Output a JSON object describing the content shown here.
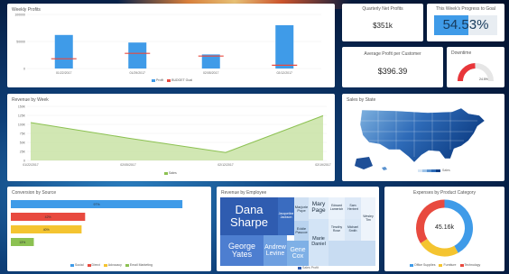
{
  "colors": {
    "primary": "#3f9be8",
    "accent_red": "#e84a3f",
    "green": "#8cc152",
    "yellow": "#f4c430",
    "gauge_red": "#e8363a"
  },
  "weekly_profits": {
    "title": "Weekly Profits",
    "y_ticks": [
      "100000",
      "50000",
      "0"
    ],
    "legend": [
      "Profit",
      "BUDGET Goal"
    ],
    "chart_data": {
      "type": "bar",
      "categories": [
        "01/22/2017",
        "01/29/2017",
        "02/05/2017",
        "02/12/2017"
      ],
      "series": [
        {
          "name": "Profit",
          "values": [
            62000,
            48000,
            26000,
            80000
          ]
        },
        {
          "name": "BUDGET Goal",
          "values": [
            18000,
            28000,
            23000,
            6000
          ]
        }
      ],
      "ylim": [
        0,
        100000
      ]
    }
  },
  "quarterly_net_profits": {
    "label": "Quarterly Net Profits",
    "value": "$351k"
  },
  "progress_to_goal": {
    "label": "This Week's Progress to Goal",
    "value": "54.53%",
    "progress": 0.5453
  },
  "avg_profit_per_customer": {
    "label": "Average Profit per Customer",
    "value": "$396.39"
  },
  "downtime": {
    "label": "Downtime",
    "value": "24.5%",
    "fraction": 0.245
  },
  "revenue_by_week": {
    "title": "Revenue by Week",
    "y_ticks": [
      "150K",
      "125K",
      "100K",
      "75K",
      "50K",
      "25K",
      "0"
    ],
    "legend": [
      "Sales"
    ],
    "chart_data": {
      "type": "area",
      "categories": [
        "01/22/2017",
        "02/05/2017",
        "02/12/2017",
        "02/19/2017"
      ],
      "series": [
        {
          "name": "Sales",
          "values": [
            105000,
            62000,
            22000,
            124000
          ]
        }
      ],
      "ylim": [
        0,
        150000
      ]
    }
  },
  "sales_by_state": {
    "title": "Sales by State",
    "legend": [
      "Sales"
    ]
  },
  "conversion_by_source": {
    "title": "Conversion by Source",
    "legend": [
      "Social",
      "Direct",
      "Advocacy",
      "Email Marketing"
    ],
    "chart_data": {
      "type": "bar",
      "categories": [
        "Social",
        "Direct",
        "Advocacy",
        "Email Marketing"
      ],
      "values": [
        97,
        42,
        40,
        13
      ],
      "labels": [
        "97%",
        "42%",
        "40%",
        "13%"
      ],
      "orientation": "horizontal"
    }
  },
  "revenue_by_employee": {
    "title": "Revenue by Employee",
    "legend": [
      "Sales Profit"
    ],
    "cells": [
      {
        "name": "Dana Sharpe"
      },
      {
        "name": "George Yates"
      },
      {
        "name": "Jacqueline Jackson"
      },
      {
        "name": "Andrew Levine"
      },
      {
        "name": "Marjorie Pope"
      },
      {
        "name": "Eddie Pascoe"
      },
      {
        "name": "Gene Cox"
      },
      {
        "name": "Mary Page"
      },
      {
        "name": "Marie Daniel"
      },
      {
        "name": "Edward Lamerich"
      },
      {
        "name": "Sam Herbert"
      },
      {
        "name": "Timothy Rose"
      },
      {
        "name": "Michael Smith"
      },
      {
        "name": "Wesley Tim"
      }
    ]
  },
  "expenses_by_category": {
    "title": "Expenses by Product Category",
    "center_value": "45.16k",
    "legend": [
      "Office Supplies",
      "Furniture",
      "Technology"
    ],
    "chart_data": {
      "type": "pie",
      "categories": [
        "Office Supplies",
        "Furniture",
        "Technology"
      ],
      "values": [
        42,
        24,
        34
      ]
    }
  }
}
